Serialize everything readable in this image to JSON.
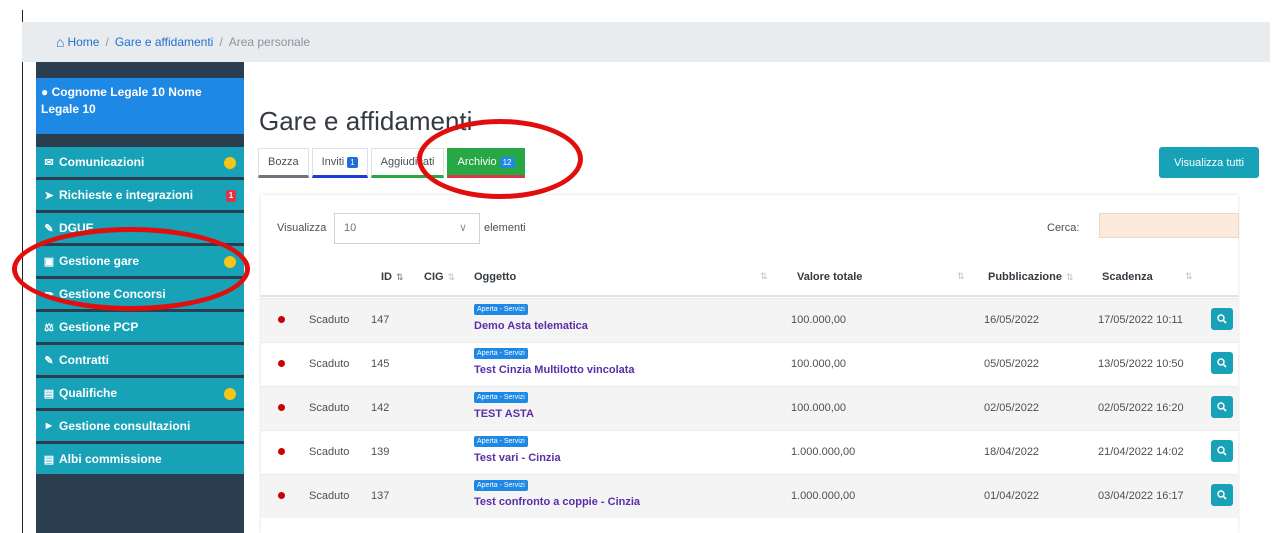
{
  "breadcrumb": {
    "home": "Home",
    "section": "Gare e affidamenti",
    "current": "Area personale",
    "separator": "/"
  },
  "sidebar": {
    "user_name": "Cognome Legale 10 Nome Legale 10",
    "items": [
      {
        "label": "Comunicazioni",
        "icon": "envelope-icon",
        "marker": "dot"
      },
      {
        "label": "Richieste e integrazioni",
        "icon": "send-icon",
        "marker": "badge",
        "badge": "1"
      },
      {
        "label": "DGUE",
        "icon": "edit-icon",
        "marker": ""
      },
      {
        "label": "Gestione gare",
        "icon": "briefcase-icon",
        "marker": "dot"
      },
      {
        "label": "Gestione Concorsi",
        "icon": "pencil-icon",
        "marker": ""
      },
      {
        "label": "Gestione PCP",
        "icon": "flask-icon",
        "marker": ""
      },
      {
        "label": "Contratti",
        "icon": "edit-icon",
        "marker": ""
      },
      {
        "label": "Qualifiche",
        "icon": "folder-icon",
        "marker": "dot"
      },
      {
        "label": "Gestione consultazioni",
        "icon": "megaphone-icon",
        "marker": ""
      },
      {
        "label": "Albi commissione",
        "icon": "folder-icon",
        "marker": ""
      }
    ]
  },
  "main": {
    "title": "Gare e affidamenti",
    "tabs": [
      {
        "label": "Bozza",
        "count": ""
      },
      {
        "label": "Inviti",
        "count": "1"
      },
      {
        "label": "Aggiudicati",
        "count": ""
      },
      {
        "label": "Archivio",
        "count": "12"
      }
    ],
    "show_all_button": "Visualizza tutti"
  },
  "table": {
    "length_label": "Visualizza",
    "length_value": "10",
    "length_after": "elementi",
    "search_label": "Cerca:",
    "columns": [
      "ID",
      "CIG",
      "Oggetto",
      "Valore totale",
      "Pubblicazione",
      "Scadenza"
    ],
    "rows": [
      {
        "status": "Scaduto",
        "id": "147",
        "tag": "Aperta - Servizi",
        "object": "Demo Asta telematica",
        "value": "100.000,00",
        "published": "16/05/2022",
        "deadline": "17/05/2022 10:11"
      },
      {
        "status": "Scaduto",
        "id": "145",
        "tag": "Aperta - Servizi",
        "object": "Test Cinzia Multilotto vincolata",
        "value": "100.000,00",
        "published": "05/05/2022",
        "deadline": "13/05/2022 10:50"
      },
      {
        "status": "Scaduto",
        "id": "142",
        "tag": "Aperta - Servizi",
        "object": "TEST ASTA",
        "value": "100.000,00",
        "published": "02/05/2022",
        "deadline": "02/05/2022 16:20"
      },
      {
        "status": "Scaduto",
        "id": "139",
        "tag": "Aperta - Servizi",
        "object": "Test vari - Cinzia",
        "value": "1.000.000,00",
        "published": "18/04/2022",
        "deadline": "21/04/2022 14:02"
      },
      {
        "status": "Scaduto",
        "id": "137",
        "tag": "Aperta - Servizi",
        "object": "Test confronto a coppie - Cinzia",
        "value": "1.000.000,00",
        "published": "01/04/2022",
        "deadline": "03/04/2022 16:17"
      }
    ]
  },
  "colors": {
    "sidebar_item": "#17a2b8",
    "sidebar_bg": "#2b3e4f",
    "user_box": "#1e88e5",
    "annotation": "#e10e0e",
    "archive_tab": "#28a745",
    "object_link": "#5a2ea6"
  }
}
